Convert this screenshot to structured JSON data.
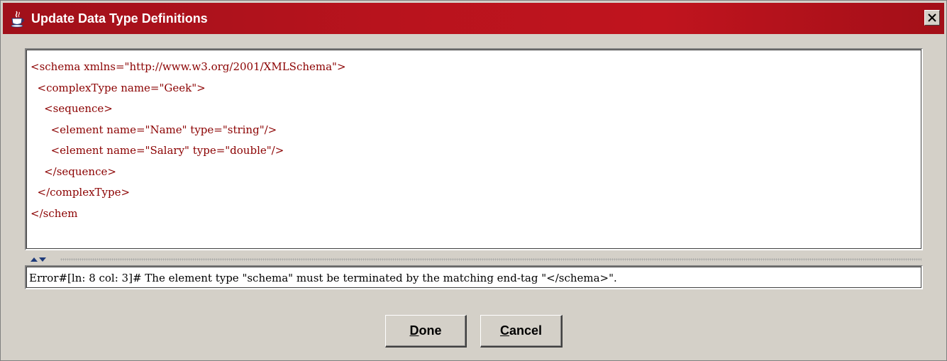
{
  "window": {
    "title": "Update Data Type Definitions",
    "title_icon": "java-coffee-cup-icon",
    "close_icon": "close-icon"
  },
  "editor": {
    "lines": [
      "<schema xmlns=\"http://www.w3.org/2001/XMLSchema\">",
      "  <complexType name=\"Geek\">",
      "    <sequence>",
      "      <element name=\"Name\" type=\"string\"/>",
      "      <element name=\"Salary\" type=\"double\"/>",
      "    </sequence>",
      "  </complexType>",
      "</schem"
    ],
    "text_color": "#8b0000"
  },
  "splitter": {
    "up_icon": "arrow-up-icon",
    "down_icon": "arrow-down-icon"
  },
  "error": {
    "message": "Error#[ln: 8 col: 3]# The element type \"schema\" must be terminated by the matching end-tag \"</schema>\"."
  },
  "buttons": {
    "done_label": "Done",
    "cancel_label": "Cancel"
  },
  "colors": {
    "titlebar": "#b8131d",
    "dialog_bg": "#d4d0c8"
  }
}
